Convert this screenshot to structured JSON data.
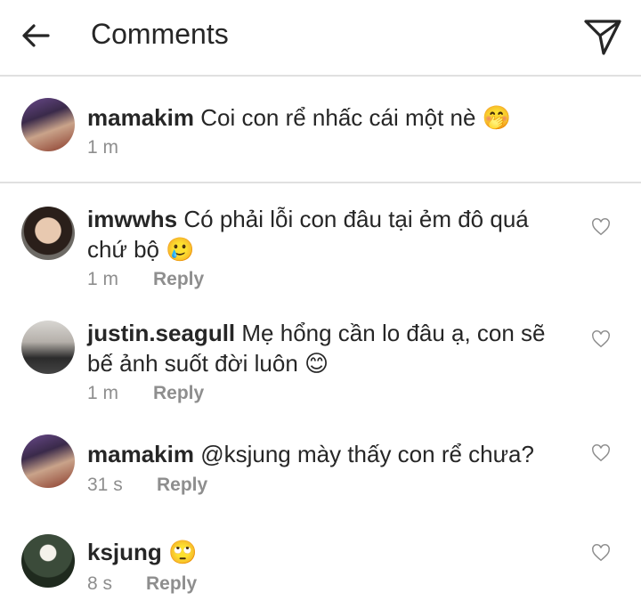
{
  "header": {
    "title": "Comments"
  },
  "caption": {
    "username": "mamakim",
    "text": "Coi con rể nhấc cái một nè",
    "emoji": "🤭",
    "time": "1 m"
  },
  "comments": [
    {
      "username": "imwwhs",
      "text_line1": "Có phải lỗi con đâu tại ẻm đô quá",
      "text_line2": "chứ bộ",
      "emoji": "🥲",
      "time": "1 m",
      "reply": "Reply"
    },
    {
      "username": "justin.seagull",
      "text_line1": "Mẹ hổng cần lo đâu ạ, con sẽ",
      "text_line2": "bế ảnh suốt đời luôn",
      "emoji": "😊",
      "time": "1 m",
      "reply": "Reply"
    },
    {
      "username": "mamakim",
      "text_line1": "@ksjung mày thấy con rể chưa?",
      "time": "31 s",
      "reply": "Reply"
    },
    {
      "username": "ksjung",
      "text_line1": "",
      "emoji": "🙄",
      "time": "8 s",
      "reply": "Reply"
    }
  ],
  "icons": {
    "back": "arrow-left-icon",
    "send": "paper-plane-icon",
    "like": "heart-outline-icon"
  }
}
